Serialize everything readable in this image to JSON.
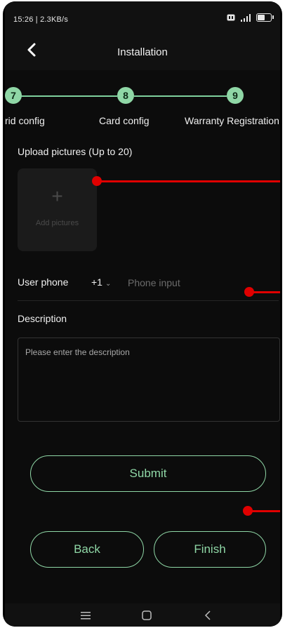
{
  "status": {
    "time_speed": "15:26 | 2.3KB/s",
    "battery_level": 0.6
  },
  "header": {
    "title": "Installation",
    "back_icon": "chevron-left-icon"
  },
  "stepper": {
    "steps": [
      {
        "number": "7",
        "label": "rid config"
      },
      {
        "number": "8",
        "label": "Card config"
      },
      {
        "number": "9",
        "label": "Warranty Registration"
      }
    ]
  },
  "upload": {
    "label": "Upload pictures (Up to 20)",
    "plus": "+",
    "button_text": "Add pictures"
  },
  "phone": {
    "label": "User phone",
    "country_code": "+1",
    "placeholder": "Phone input"
  },
  "description": {
    "label": "Description",
    "placeholder": "Please enter the description"
  },
  "actions": {
    "submit": "Submit",
    "back": "Back",
    "finish": "Finish"
  },
  "colors": {
    "accent": "#8fd7a6",
    "annotation": "#e00000",
    "background": "#0c0c0c"
  }
}
